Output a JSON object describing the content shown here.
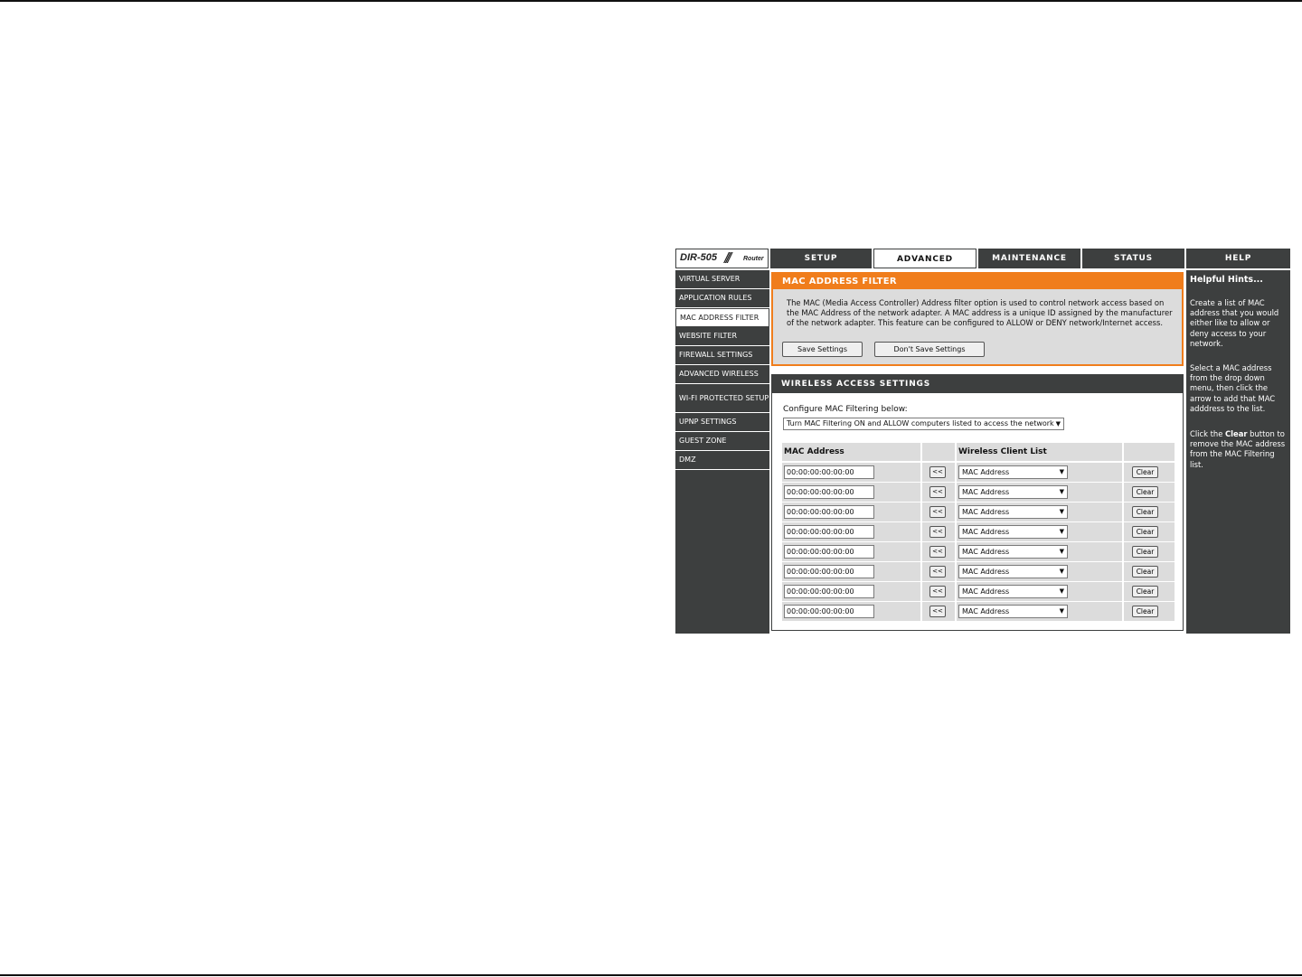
{
  "logo": {
    "model": "DIR-505",
    "slashes": "///",
    "router": "Router"
  },
  "tabs": [
    {
      "label": "SETUP",
      "active": false
    },
    {
      "label": "ADVANCED",
      "active": true
    },
    {
      "label": "MAINTENANCE",
      "active": false
    },
    {
      "label": "STATUS",
      "active": false
    },
    {
      "label": "HELP",
      "active": false
    }
  ],
  "sidebar": {
    "items": [
      {
        "label": "VIRTUAL SERVER",
        "active": false
      },
      {
        "label": "APPLICATION RULES",
        "active": false
      },
      {
        "label": "MAC ADDRESS FILTER",
        "active": true
      },
      {
        "label": "WEBSITE FILTER",
        "active": false
      },
      {
        "label": "FIREWALL SETTINGS",
        "active": false
      },
      {
        "label": "ADVANCED WIRELESS",
        "active": false
      },
      {
        "label": "WI-FI PROTECTED SETUP",
        "active": false
      },
      {
        "label": "UPNP SETTINGS",
        "active": false
      },
      {
        "label": "GUEST ZONE",
        "active": false
      },
      {
        "label": "DMZ",
        "active": false
      }
    ]
  },
  "mac_filter": {
    "title": "MAC ADDRESS FILTER",
    "description": "The MAC (Media Access Controller) Address filter option is used to control network access based on the MAC Address of the network adapter. A MAC address is a unique ID assigned by the manufacturer of the network adapter. This feature can be configured to ALLOW or DENY network/Internet access.",
    "save_label": "Save Settings",
    "dont_save_label": "Don't Save Settings"
  },
  "wireless": {
    "title": "WIRELESS ACCESS SETTINGS",
    "configure_label": "Configure MAC Filtering below:",
    "filter_mode": "Turn MAC Filtering ON and ALLOW computers listed to access the network",
    "col_mac": "MAC Address",
    "col_client": "Wireless Client List",
    "arrow_label": "<<",
    "clear_label": "Clear",
    "rows": [
      {
        "mac": "00:00:00:00:00:00",
        "client": "MAC Address"
      },
      {
        "mac": "00:00:00:00:00:00",
        "client": "MAC Address"
      },
      {
        "mac": "00:00:00:00:00:00",
        "client": "MAC Address"
      },
      {
        "mac": "00:00:00:00:00:00",
        "client": "MAC Address"
      },
      {
        "mac": "00:00:00:00:00:00",
        "client": "MAC Address"
      },
      {
        "mac": "00:00:00:00:00:00",
        "client": "MAC Address"
      },
      {
        "mac": "00:00:00:00:00:00",
        "client": "MAC Address"
      },
      {
        "mac": "00:00:00:00:00:00",
        "client": "MAC Address"
      }
    ]
  },
  "hints": {
    "title": "Helpful Hints...",
    "p1": "Create a list of MAC address that you would either like to allow or deny access to your network.",
    "p2": "Select a MAC address from the drop down menu, then click the arrow to add that MAC adddress to the list.",
    "p3_before": "Click the ",
    "p3_bold": "Clear",
    "p3_after": " button to remove the MAC address from the MAC Filtering list."
  },
  "colors": {
    "dark": "#3d3f3f",
    "accent": "#f07d1c",
    "panel": "#dcdcdc"
  }
}
